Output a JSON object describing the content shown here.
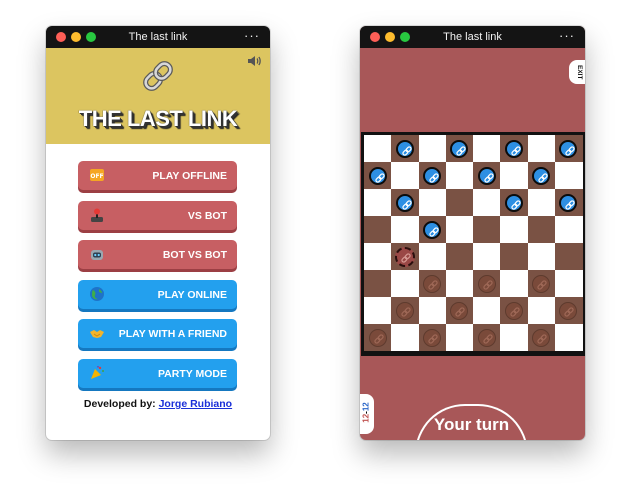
{
  "colors": {
    "hero_bg": "#dcc560",
    "red_button": "#c75f63",
    "blue_button": "#23a0ee",
    "game_bg": "#a85758",
    "board_dark": "#7a5244",
    "blue_piece": "#2d8fe3",
    "brown_piece": "#7b4a3a"
  },
  "left_window": {
    "title": "The last link",
    "more": "···",
    "logo_icon": "chain-link-icon",
    "sound_icon": "speaker-icon",
    "hero_title": "THE LAST LINK",
    "buttons": [
      {
        "label": "PLAY OFFLINE",
        "icon": "offline-icon",
        "style": "red"
      },
      {
        "label": "VS BOT",
        "icon": "joystick-icon",
        "style": "red"
      },
      {
        "label": "BOT VS BOT",
        "icon": "robot-icon",
        "style": "red"
      },
      {
        "label": "PLAY ONLINE",
        "icon": "globe-icon",
        "style": "blue"
      },
      {
        "label": "PLAY WITH A FRIEND",
        "icon": "handshake-icon",
        "style": "blue"
      },
      {
        "label": "PARTY MODE",
        "icon": "party-icon",
        "style": "blue"
      }
    ],
    "credits_prefix": "Developed by:",
    "credits_name": "Jorge Rubiano"
  },
  "right_window": {
    "title": "The last link",
    "more": "···",
    "exit_label": "EXIT",
    "score_left": "12",
    "score_sep": "-",
    "score_right": "12",
    "turn_label": "Your turn",
    "board": {
      "rows": 8,
      "cols": 8,
      "blue_pieces": [
        [
          0,
          1
        ],
        [
          0,
          3
        ],
        [
          0,
          5
        ],
        [
          0,
          7
        ],
        [
          1,
          0
        ],
        [
          1,
          2
        ],
        [
          1,
          4
        ],
        [
          1,
          6
        ],
        [
          2,
          1
        ],
        [
          2,
          5
        ],
        [
          2,
          7
        ],
        [
          3,
          2
        ]
      ],
      "brown_pieces": [
        [
          5,
          2
        ],
        [
          5,
          4
        ],
        [
          5,
          6
        ],
        [
          6,
          1
        ],
        [
          6,
          3
        ],
        [
          6,
          5
        ],
        [
          6,
          7
        ],
        [
          7,
          0
        ],
        [
          7,
          2
        ],
        [
          7,
          4
        ],
        [
          7,
          6
        ]
      ],
      "selected_piece": [
        4,
        1
      ]
    }
  }
}
